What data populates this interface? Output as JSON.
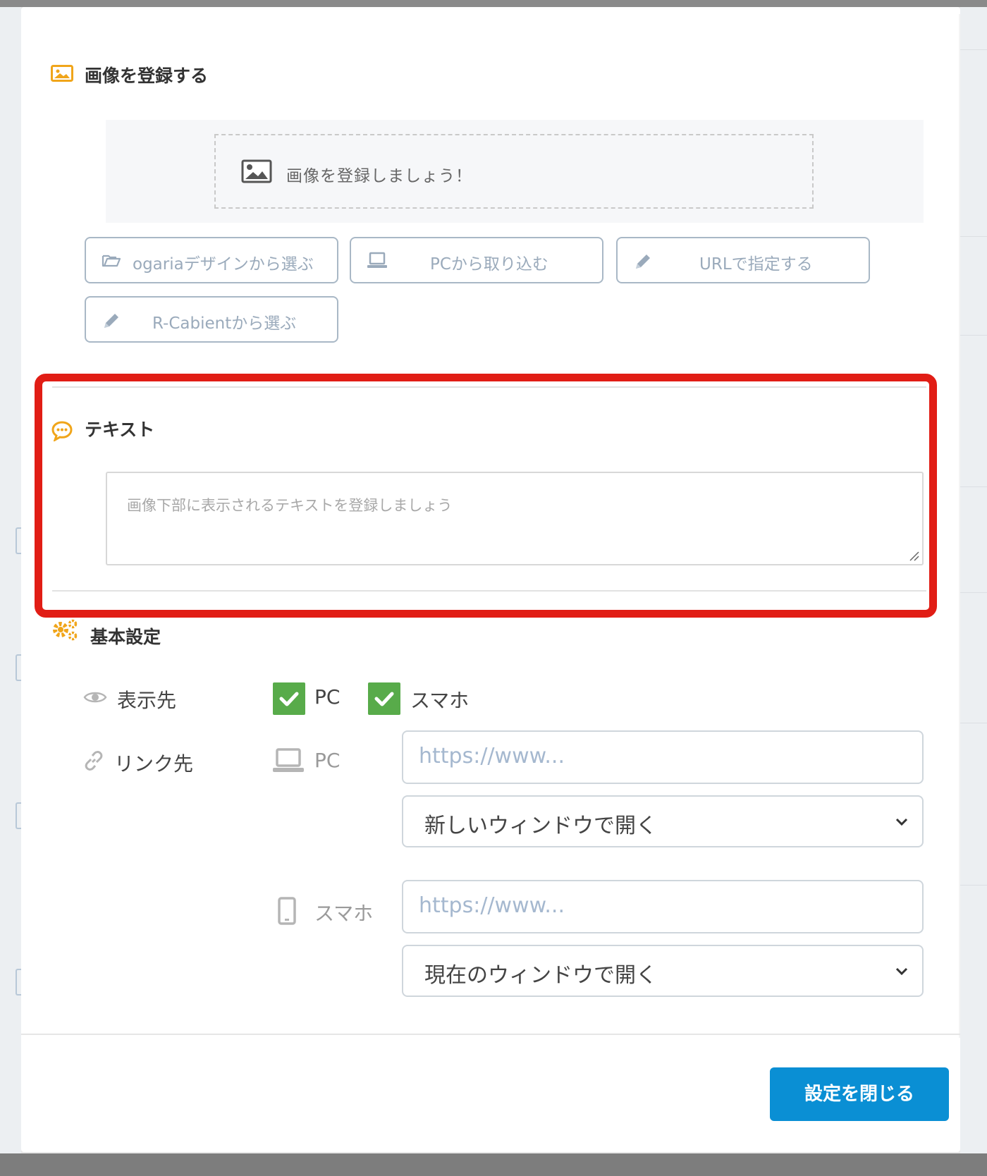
{
  "image_section": {
    "title": "画像を登録する",
    "dropzone_text": "画像を登録しましょう！",
    "buttons": [
      {
        "label": "ogariaデザインから選ぶ",
        "icon": "folder-open-icon"
      },
      {
        "label": "PCから取り込む",
        "icon": "laptop-icon"
      },
      {
        "label": "URLで指定する",
        "icon": "pencil-icon"
      },
      {
        "label": "R-Cabientから選ぶ",
        "icon": "pencil-icon"
      }
    ]
  },
  "text_section": {
    "title": "テキスト",
    "placeholder": "画像下部に表示されるテキストを登録しましょう"
  },
  "basic_settings": {
    "title": "基本設定",
    "display_label": "表示先",
    "display_options": [
      {
        "label": "PC",
        "checked": true
      },
      {
        "label": "スマホ",
        "checked": true
      }
    ],
    "link_label": "リンク先",
    "pc": {
      "label": "PC",
      "url_placeholder": "https://www...",
      "target": "新しいウィンドウで開く"
    },
    "sp": {
      "label": "スマホ",
      "url_placeholder": "https://www...",
      "target": "現在のウィンドウで開く"
    }
  },
  "footer": {
    "close_label": "設定を閉じる"
  },
  "colors": {
    "accent": "#f0a51a",
    "primary": "#0a8fd4",
    "check": "#58ab4a",
    "highlight": "#e11d15"
  }
}
